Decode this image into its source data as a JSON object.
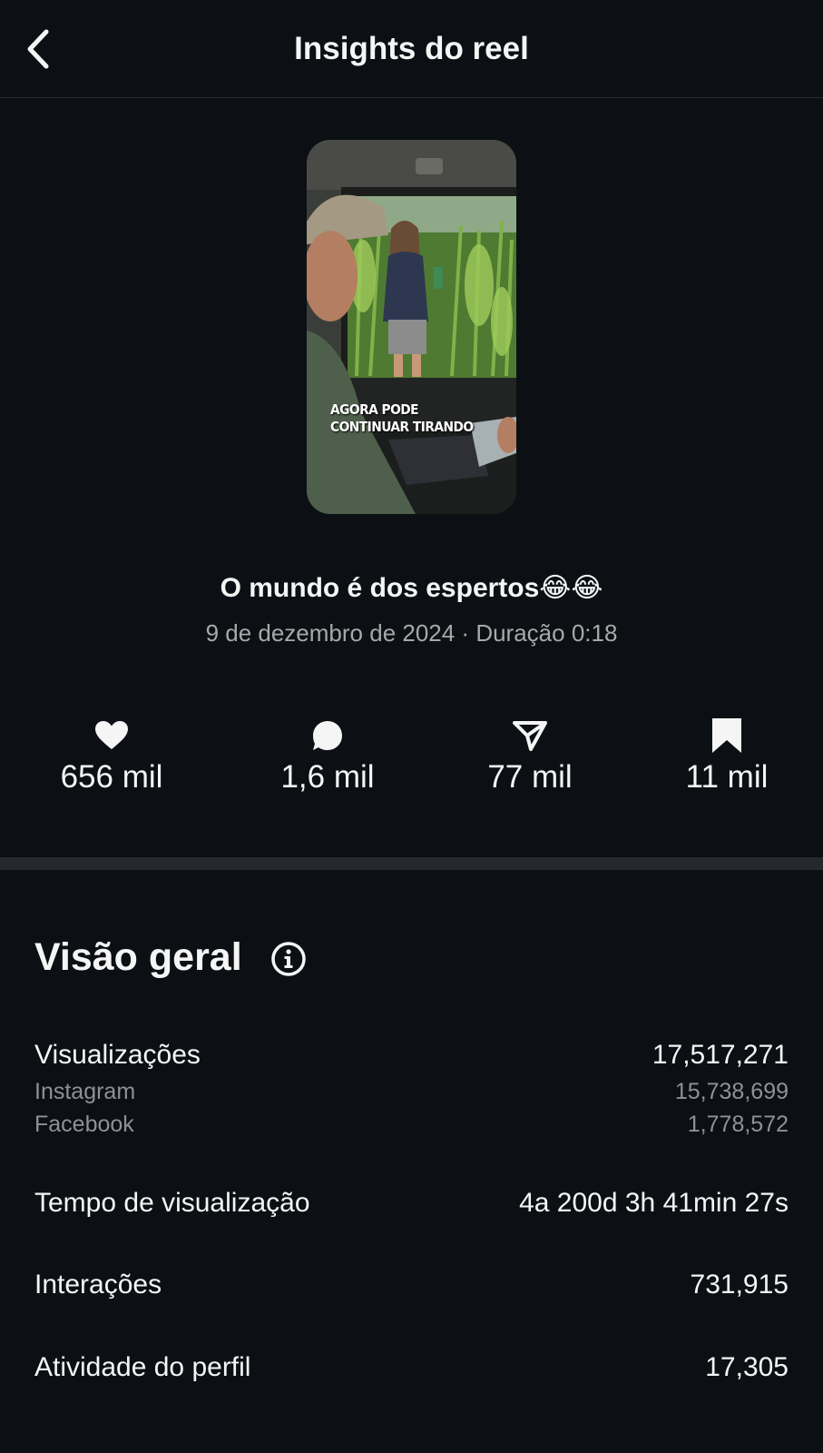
{
  "header": {
    "title": "Insights do reel",
    "back_icon": "chevron-left-icon"
  },
  "reel": {
    "caption_overlay": "AGORA PODE CONTINUAR TIRANDO",
    "title": "O mundo é dos espertos😂😂",
    "meta": "9 de dezembro de 2024 · Duração 0:18"
  },
  "stats": [
    {
      "icon": "heart-icon",
      "value": "656 mil"
    },
    {
      "icon": "comment-icon",
      "value": "1,6 mil"
    },
    {
      "icon": "share-icon",
      "value": "77 mil"
    },
    {
      "icon": "bookmark-icon",
      "value": "11 mil"
    }
  ],
  "overview": {
    "title": "Visão geral",
    "info_icon": "info-icon",
    "views": {
      "label": "Visualizações",
      "value": "17,517,271",
      "breakdown": [
        {
          "label": "Instagram",
          "value": "15,738,699"
        },
        {
          "label": "Facebook",
          "value": "1,778,572"
        }
      ]
    },
    "watch_time": {
      "label": "Tempo de visualização",
      "value": "4a 200d 3h 41min 27s"
    },
    "interactions": {
      "label": "Interações",
      "value": "731,915"
    },
    "profile_activity": {
      "label": "Atividade do perfil",
      "value": "17,305"
    }
  },
  "colors": {
    "background": "#0c1014",
    "text_primary": "#f5f5f5",
    "text_secondary": "#a8a8a8",
    "divider": "#25292d"
  }
}
